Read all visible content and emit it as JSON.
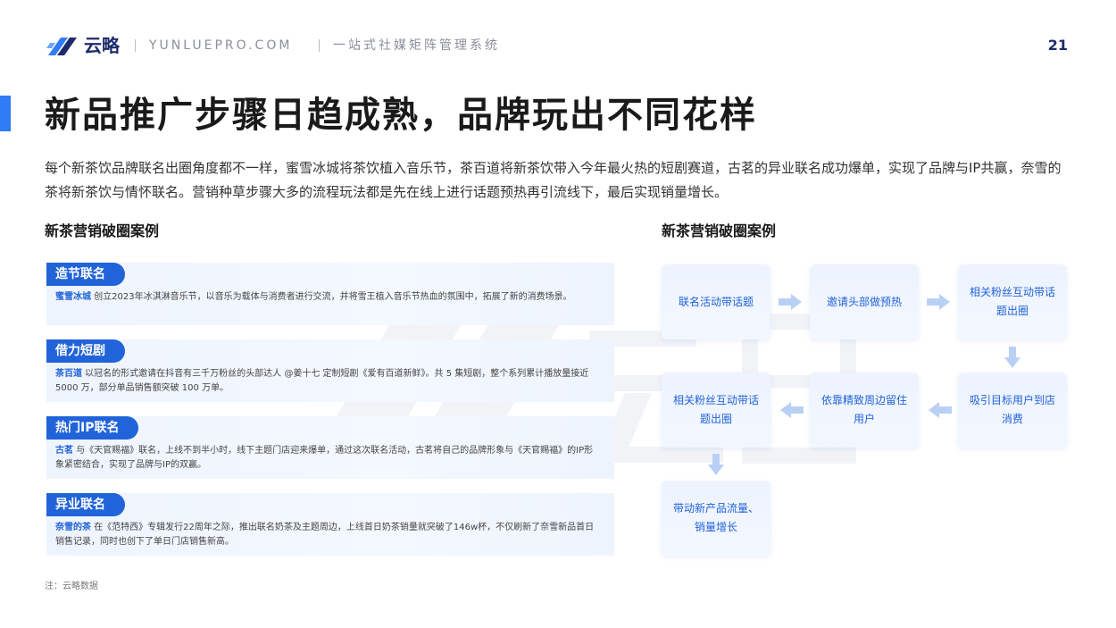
{
  "header": {
    "brand": "云略",
    "site": "YUNLUEPRO.COM",
    "tagline": "一站式社媒矩阵管理系统",
    "page_number": "21"
  },
  "title": "新品推广步骤日趋成熟，品牌玩出不同花样",
  "intro": "每个新茶饮品牌联名出圈角度都不一样，蜜雪冰城将茶饮植入音乐节，茶百道将新茶饮带入今年最火热的短剧赛道，古茗的异业联名成功爆单，实现了品牌与IP共赢，奈雪的茶将新茶饮与情怀联名。营销种草步骤大多的流程玩法都是先在线上进行话题预热再引流线下，最后实现销量增长。",
  "left_section_title": "新茶营销破圈案例",
  "right_section_title": "新茶营销破圈案例",
  "cases": [
    {
      "tag": "造节联名",
      "name": "蜜雪冰城",
      "text": " 创立2023年冰淇淋音乐节，以音乐为载体与消费者进行交流，并将雪王植入音乐节热血的氛围中，拓展了新的消费场景。"
    },
    {
      "tag": "借力短剧",
      "name": "茶百道",
      "text": " 以冠名的形式邀请在抖音有三千万粉丝的头部达人 @姜十七 定制短剧《爱有百道新鲜》。共 5 集短剧，整个系列累计播放量接近 5000 万，部分单品销售额突破 100 万单。"
    },
    {
      "tag": "热门IP联名",
      "name": "古茗",
      "text": " 与《天官赐福》联名，上线不到半小时，线下主题门店迎来爆单，通过这次联名活动，古茗将自己的品牌形象与《天官赐福》的IP形象紧密结合，实现了品牌与IP的双赢。"
    },
    {
      "tag": "异业联名",
      "name": "奈雪的茶",
      "text": " 在《范特西》专辑发行22周年之际，推出联名奶茶及主题周边，上线首日奶茶销量就突破了146w杯，不仅刷新了奈雪新品首日销售记录，同时也创下了单日门店销售新高。"
    }
  ],
  "flow": [
    "联名活动带话题",
    "邀请头部做预热",
    "相关粉丝互动带话题出圈",
    "吸引目标用户到店消费",
    "依靠精致周边留住用户",
    "相关粉丝互动带话题出圈",
    "带动新产品流量、销量增长"
  ],
  "note": "注：云略数据",
  "colors": {
    "accent": "#2163d9",
    "title_bar": "#2f7cf6",
    "brand": "#1d2a6b"
  }
}
